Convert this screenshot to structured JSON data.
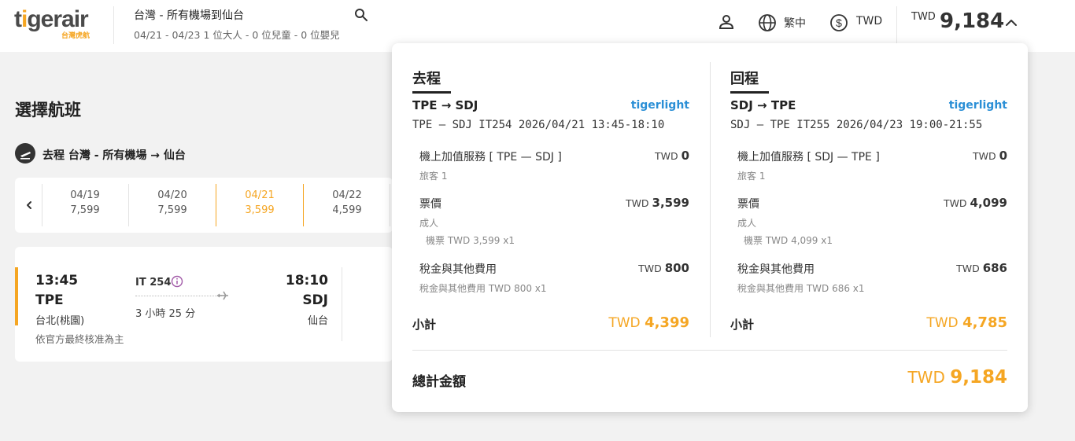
{
  "header": {
    "logo_text": "tigerair",
    "logo_sub": "台灣虎航",
    "route_title": "台灣 - 所有機場到仙台",
    "route_sub": "04/21 - 04/23  1 位大人 - 0 位兒童 - 0 位嬰兒",
    "language": "繁中",
    "currency": "TWD",
    "total_currency": "TWD",
    "total_value": "9,184"
  },
  "main": {
    "page_title": "選擇航班",
    "segment_label": "去程  台灣 - 所有機場 → 仙台",
    "dates": [
      {
        "date": "04/19",
        "price": "7,599"
      },
      {
        "date": "04/20",
        "price": "7,599"
      },
      {
        "date": "04/21",
        "price": "3,599"
      },
      {
        "date": "04/22",
        "price": "4,599"
      }
    ],
    "flight": {
      "dep_time": "13:45",
      "dep_code": "TPE",
      "dep_city": "台北(桃園)",
      "flight_no": "IT 254",
      "duration": "3 小時 25 分",
      "arr_time": "18:10",
      "arr_code": "SDJ",
      "arr_city": "仙台",
      "note": "依官方最終核准為主"
    }
  },
  "panel": {
    "outbound": {
      "heading": "去程",
      "sector": "TPE → SDJ",
      "brand": "tigerlight",
      "flight_line": "TPE — SDJ  IT254 2026/04/21 13:45-18:10",
      "addon_title": "機上加值服務 [ TPE — SDJ ]",
      "addon_sub": "旅客 1",
      "addon_cur": "TWD",
      "addon_amt": "0",
      "fare_title": "票價",
      "fare_sub": "成人",
      "fare_detail": "機票 TWD 3,599 x1",
      "fare_cur": "TWD",
      "fare_amt": "3,599",
      "tax_title": "稅金與其他費用",
      "tax_detail": "稅金與其他費用 TWD 800 x1",
      "tax_cur": "TWD",
      "tax_amt": "800",
      "subtotal_label": "小計",
      "subtotal_cur": "TWD",
      "subtotal_amt": "4,399"
    },
    "return": {
      "heading": "回程",
      "sector": "SDJ → TPE",
      "brand": "tigerlight",
      "flight_line": "SDJ — TPE  IT255 2026/04/23 19:00-21:55",
      "addon_title": "機上加值服務 [ SDJ — TPE ]",
      "addon_sub": "旅客 1",
      "addon_cur": "TWD",
      "addon_amt": "0",
      "fare_title": "票價",
      "fare_sub": "成人",
      "fare_detail": "機票 TWD 4,099 x1",
      "fare_cur": "TWD",
      "fare_amt": "4,099",
      "tax_title": "稅金與其他費用",
      "tax_detail": "稅金與其他費用 TWD 686 x1",
      "tax_cur": "TWD",
      "tax_amt": "686",
      "subtotal_label": "小計",
      "subtotal_cur": "TWD",
      "subtotal_amt": "4,785"
    },
    "grand_label": "總計金額",
    "grand_cur": "TWD",
    "grand_amt": "9,184"
  },
  "colors": {
    "accent": "#f5a623",
    "brand_blue": "#2b8fd6",
    "text": "#222222"
  }
}
